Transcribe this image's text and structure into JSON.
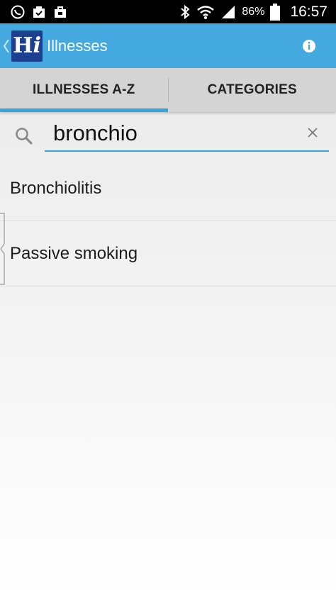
{
  "status_bar": {
    "battery_percent": "86%",
    "time": "16:57",
    "left_icons": [
      "whatsapp-icon",
      "clipboard-check-icon",
      "bag-icon"
    ],
    "right_icons": [
      "bluetooth-icon",
      "wifi-icon",
      "signal-icon",
      "battery-icon"
    ]
  },
  "app_bar": {
    "logo_text_h": "H",
    "logo_text_i": "i",
    "title": "Illnesses",
    "background_color": "#44a9de",
    "logo_color": "#1c3f8f"
  },
  "tabs": [
    {
      "label": "ILLNESSES A-Z",
      "active": true
    },
    {
      "label": "CATEGORIES",
      "active": false
    }
  ],
  "search": {
    "value": "bronchio",
    "accent_color": "#33a6dd"
  },
  "results": [
    {
      "label": "Bronchiolitis"
    },
    {
      "label": "Passive smoking"
    }
  ]
}
